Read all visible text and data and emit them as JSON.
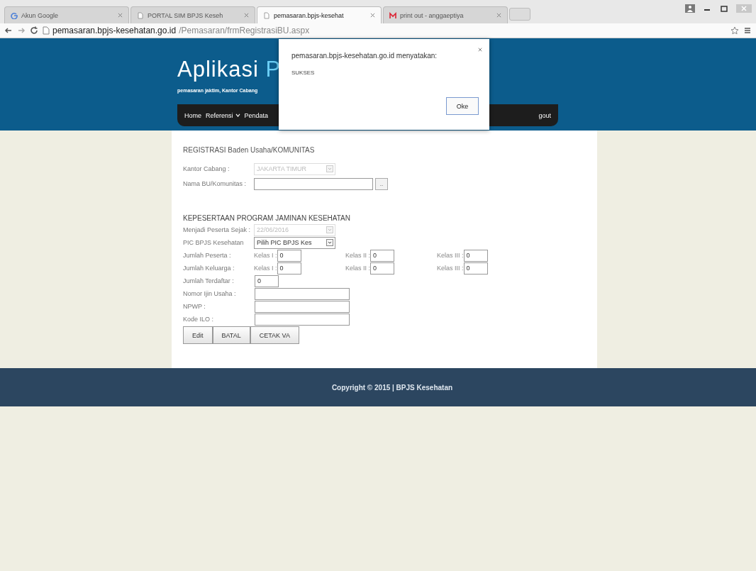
{
  "browser": {
    "tabs": [
      {
        "label": "Akun Google",
        "selected": false
      },
      {
        "label": "PORTAL SIM BPJS Keseh",
        "selected": false
      },
      {
        "label": "pemasaran.bpjs-kesehat",
        "selected": true
      },
      {
        "label": "print out - anggaeptiya",
        "selected": false
      }
    ],
    "address": {
      "host": "pemasaran.bpjs-kesehatan.go.id",
      "path": "/Pemasaran/frmRegistrasiBU.aspx"
    }
  },
  "header": {
    "title": "Aplikasi",
    "title_accent": "P",
    "subtitle": "pemasaran jaktim, Kantor Cabang",
    "nav": [
      {
        "label": "Home",
        "has_menu": false
      },
      {
        "label": "Referensi",
        "has_menu": true
      },
      {
        "label": "Pendata",
        "has_menu": false
      }
    ],
    "nav_right": "gout"
  },
  "form": {
    "sections": [
      {
        "title": "REGISTRASI Baden Usaha/KOMUNITAS",
        "rows": [
          {
            "kind": "select",
            "label": "Kantor Cabang :",
            "value": "JAKARTA TIMUR",
            "disabled": true
          },
          {
            "kind": "lookup",
            "label": "Nama BU/Komunitas :",
            "button": ".."
          }
        ]
      },
      {
        "title": "KEPESERTAAN PROGRAM JAMINAN KESEHATAN",
        "rows": [
          {
            "kind": "select",
            "label": "Menjadi Peserta Sejak :",
            "value": "22/06/2016",
            "disabled": true
          },
          {
            "kind": "select",
            "label": "PIC BPJS Kesehatan",
            "value": "Pilih PIC BPJS Kes",
            "disabled": false
          },
          {
            "kind": "counts",
            "label": "Jumlah Peserta :",
            "fields": [
              {
                "label": "Kelas I :",
                "value": "0"
              },
              {
                "label": "Kelas II :",
                "value": "0"
              },
              {
                "label": "Kelas III :",
                "value": "0"
              }
            ]
          },
          {
            "kind": "counts",
            "label": "Jumlah Keluarga :",
            "fields": [
              {
                "label": "Kelas I :",
                "value": "0"
              },
              {
                "label": "Kelas II :",
                "value": "0"
              },
              {
                "label": "Kelas III :",
                "value": "0"
              }
            ]
          },
          {
            "kind": "short",
            "label": "Jumlah Terdaftar :",
            "value": "0"
          },
          {
            "kind": "text",
            "label": "Nomor Ijin Usaha :"
          },
          {
            "kind": "text",
            "label": "NPWP :"
          },
          {
            "kind": "text",
            "label": "Kode ILO :"
          }
        ]
      }
    ],
    "buttons": [
      "Edit",
      "BATAL",
      "CETAK VA"
    ]
  },
  "footer": "Copyright © 2015 | BPJS Kesehatan",
  "dialog": {
    "message": "pemasaran.bpjs-kesehatan.go.id menyatakan:",
    "body": "SUKSES",
    "button": "Oke"
  }
}
